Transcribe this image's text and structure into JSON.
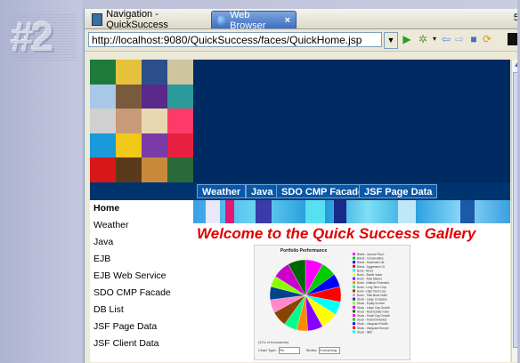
{
  "step_badge": "#2",
  "tabs": [
    {
      "label": "Navigation - QuickSuccess",
      "icon": "navigation-view-icon"
    },
    {
      "label": "Web Browser",
      "icon": "globe-icon",
      "close": "×"
    }
  ],
  "tab_overflow": "5",
  "address": {
    "url": "http://localhost:9080/QuickSuccess/faces/QuickHome.jsp"
  },
  "toolbar_icons": [
    "dropdown-arrow-icon",
    "go-icon",
    "favorites-icon",
    "back-icon",
    "forward-icon",
    "stop-icon",
    "refresh-icon"
  ],
  "menubar": [
    "Weather",
    "Java",
    "SDO CMP Facade",
    "JSF Page Data"
  ],
  "leftnav": [
    "Home",
    "Weather",
    "Java",
    "EJB",
    "EJB Web Service",
    "SDO CMP Facade",
    "DB List",
    "JSF Page Data",
    "JSF Client Data"
  ],
  "welcome": "Welcome to the Quick Success Gallery",
  "chart_data": {
    "type": "pie",
    "title": "Portfolio Performance",
    "subtitle": "(10's of thousands)",
    "slices": [
      8,
      7,
      6,
      7,
      6,
      8,
      7,
      5,
      6,
      7,
      6,
      6,
      5,
      8,
      8
    ],
    "colors": [
      "#ff00ff",
      "#00cc00",
      "#0000ff",
      "#ff0000",
      "#00ffff",
      "#ffff00",
      "#8800ff",
      "#ff8800",
      "#00ff88",
      "#884400",
      "#ff88cc",
      "#004488",
      "#88ff00",
      "#cc00cc",
      "#006600"
    ],
    "legend": [
      "Blend - Income Plus L",
      "Blend - Conservative",
      "Blend - Moderate Life",
      "Blend - Aggressive Gr",
      "Bond - Bond",
      "Bond - Stable Value",
      "Bond - Total Market",
      "Bond - Inflation Protected",
      "Bond - Long Term Corp",
      "Bond - High Yield Corp",
      "Bond - Total Bond Index",
      "Stock - Large Company",
      "Stock - Equity Income",
      "Stock - Large Cap Growth",
      "Stock - Real Estate Index",
      "Stock - Small Cap Growth",
      "Stock - Total Intl Market",
      "Stock - Vanguard Pacific",
      "Stock - Vanguard Europe",
      "Stock - IBM"
    ]
  },
  "chart_controls": {
    "type_label": "Chart Type:",
    "type_value": "Pie",
    "series_label": "Series:",
    "series_value": "Everything"
  }
}
